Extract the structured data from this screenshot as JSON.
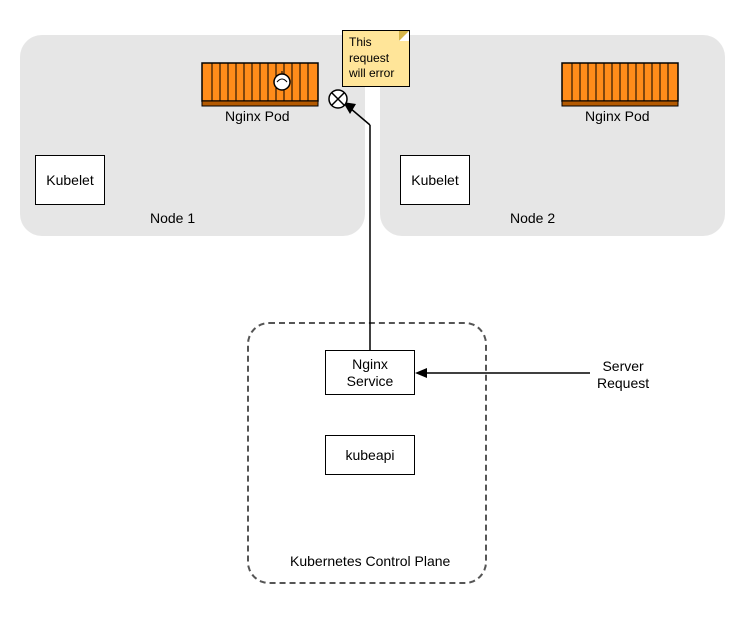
{
  "node1": {
    "label": "Node 1",
    "kubelet": "Kubelet",
    "pod": "Nginx Pod"
  },
  "node2": {
    "label": "Node 2",
    "kubelet": "Kubelet",
    "pod": "Nginx Pod"
  },
  "note": {
    "line1": "This",
    "line2": "request",
    "line3": "will error"
  },
  "service": {
    "label": "Nginx\nService"
  },
  "kubeapi": {
    "label": "kubeapi"
  },
  "controlPlane": {
    "label": "Kubernetes Control Plane"
  },
  "serverRequest": {
    "label": "Server\nRequest"
  }
}
